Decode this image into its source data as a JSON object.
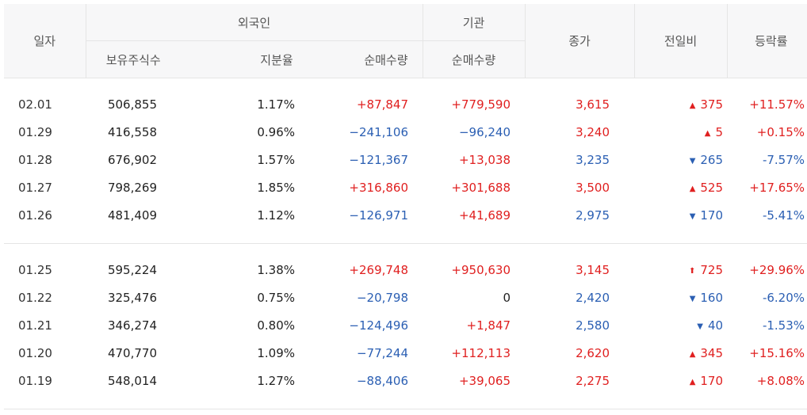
{
  "headers": {
    "date": "일자",
    "foreign_group": "외국인",
    "institution_group": "기관",
    "holdings": "보유주식수",
    "share_ratio": "지분율",
    "foreign_net": "순매수량",
    "inst_net": "순매수량",
    "close": "종가",
    "change": "전일비",
    "rate": "등락률"
  },
  "groups": [
    {
      "rows": [
        {
          "date": "02.01",
          "holdings": "506,855",
          "ratio": "1.17%",
          "fnet": "+87,847",
          "fnet_dir": "up",
          "inet": "+779,590",
          "inet_dir": "up",
          "close": "3,615",
          "close_dir": "up",
          "change": "375",
          "change_sym": "▲",
          "change_dir": "up",
          "rate": "+11.57%",
          "rate_dir": "up"
        },
        {
          "date": "01.29",
          "holdings": "416,558",
          "ratio": "0.96%",
          "fnet": "−241,106",
          "fnet_dir": "down",
          "inet": "−96,240",
          "inet_dir": "down",
          "close": "3,240",
          "close_dir": "up",
          "change": "5",
          "change_sym": "▲",
          "change_dir": "up",
          "rate": "+0.15%",
          "rate_dir": "up"
        },
        {
          "date": "01.28",
          "holdings": "676,902",
          "ratio": "1.57%",
          "fnet": "−121,367",
          "fnet_dir": "down",
          "inet": "+13,038",
          "inet_dir": "up",
          "close": "3,235",
          "close_dir": "down",
          "change": "265",
          "change_sym": "▼",
          "change_dir": "down",
          "rate": "-7.57%",
          "rate_dir": "down"
        },
        {
          "date": "01.27",
          "holdings": "798,269",
          "ratio": "1.85%",
          "fnet": "+316,860",
          "fnet_dir": "up",
          "inet": "+301,688",
          "inet_dir": "up",
          "close": "3,500",
          "close_dir": "up",
          "change": "525",
          "change_sym": "▲",
          "change_dir": "up",
          "rate": "+17.65%",
          "rate_dir": "up"
        },
        {
          "date": "01.26",
          "holdings": "481,409",
          "ratio": "1.12%",
          "fnet": "−126,971",
          "fnet_dir": "down",
          "inet": "+41,689",
          "inet_dir": "up",
          "close": "2,975",
          "close_dir": "down",
          "change": "170",
          "change_sym": "▼",
          "change_dir": "down",
          "rate": "-5.41%",
          "rate_dir": "down"
        }
      ]
    },
    {
      "rows": [
        {
          "date": "01.25",
          "holdings": "595,224",
          "ratio": "1.38%",
          "fnet": "+269,748",
          "fnet_dir": "up",
          "inet": "+950,630",
          "inet_dir": "up",
          "close": "3,145",
          "close_dir": "up",
          "change": "725",
          "change_sym": "⬆",
          "change_dir": "up",
          "rate": "+29.96%",
          "rate_dir": "up"
        },
        {
          "date": "01.22",
          "holdings": "325,476",
          "ratio": "0.75%",
          "fnet": "−20,798",
          "fnet_dir": "down",
          "inet": "0",
          "inet_dir": "flat",
          "close": "2,420",
          "close_dir": "down",
          "change": "160",
          "change_sym": "▼",
          "change_dir": "down",
          "rate": "-6.20%",
          "rate_dir": "down"
        },
        {
          "date": "01.21",
          "holdings": "346,274",
          "ratio": "0.80%",
          "fnet": "−124,496",
          "fnet_dir": "down",
          "inet": "+1,847",
          "inet_dir": "up",
          "close": "2,580",
          "close_dir": "down",
          "change": "40",
          "change_sym": "▼",
          "change_dir": "down",
          "rate": "-1.53%",
          "rate_dir": "down"
        },
        {
          "date": "01.20",
          "holdings": "470,770",
          "ratio": "1.09%",
          "fnet": "−77,244",
          "fnet_dir": "down",
          "inet": "+112,113",
          "inet_dir": "up",
          "close": "2,620",
          "close_dir": "up",
          "change": "345",
          "change_sym": "▲",
          "change_dir": "up",
          "rate": "+15.16%",
          "rate_dir": "up"
        },
        {
          "date": "01.19",
          "holdings": "548,014",
          "ratio": "1.27%",
          "fnet": "−88,406",
          "fnet_dir": "down",
          "inet": "+39,065",
          "inet_dir": "up",
          "close": "2,275",
          "close_dir": "up",
          "change": "170",
          "change_sym": "▲",
          "change_dir": "up",
          "rate": "+8.08%",
          "rate_dir": "up"
        }
      ]
    }
  ],
  "colors": {
    "up": "#e02020",
    "down": "#2b5fb3",
    "flat": "#222222",
    "header_bg": "#f7f7f8",
    "border": "#e5e5e5"
  }
}
